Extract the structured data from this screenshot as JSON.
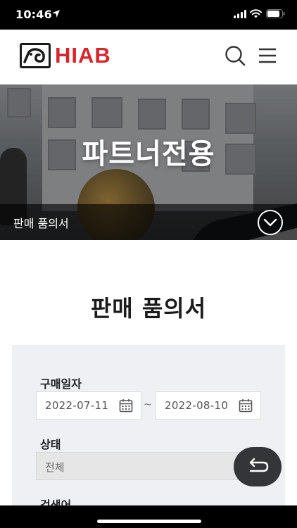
{
  "status_bar": {
    "time": "10:46"
  },
  "header": {
    "logo_text": "HIAB",
    "brand_color": "#d7262b",
    "search_icon": "search-icon",
    "menu_icon": "hamburger-menu-icon"
  },
  "hero": {
    "title": "파트너전용",
    "subnav_label": "판매 품의서",
    "toggle_icon": "chevron-down-circle-icon"
  },
  "page": {
    "title": "판매 품의서"
  },
  "form": {
    "purchase_date": {
      "label": "구매일자",
      "start": "2022-07-11",
      "separator": "~",
      "end": "2022-08-10",
      "icon": "calendar-icon"
    },
    "status": {
      "label": "상태",
      "selected": "전체"
    },
    "keyword": {
      "label": "검색어"
    }
  },
  "fab": {
    "icon": "return-arrow-icon"
  }
}
